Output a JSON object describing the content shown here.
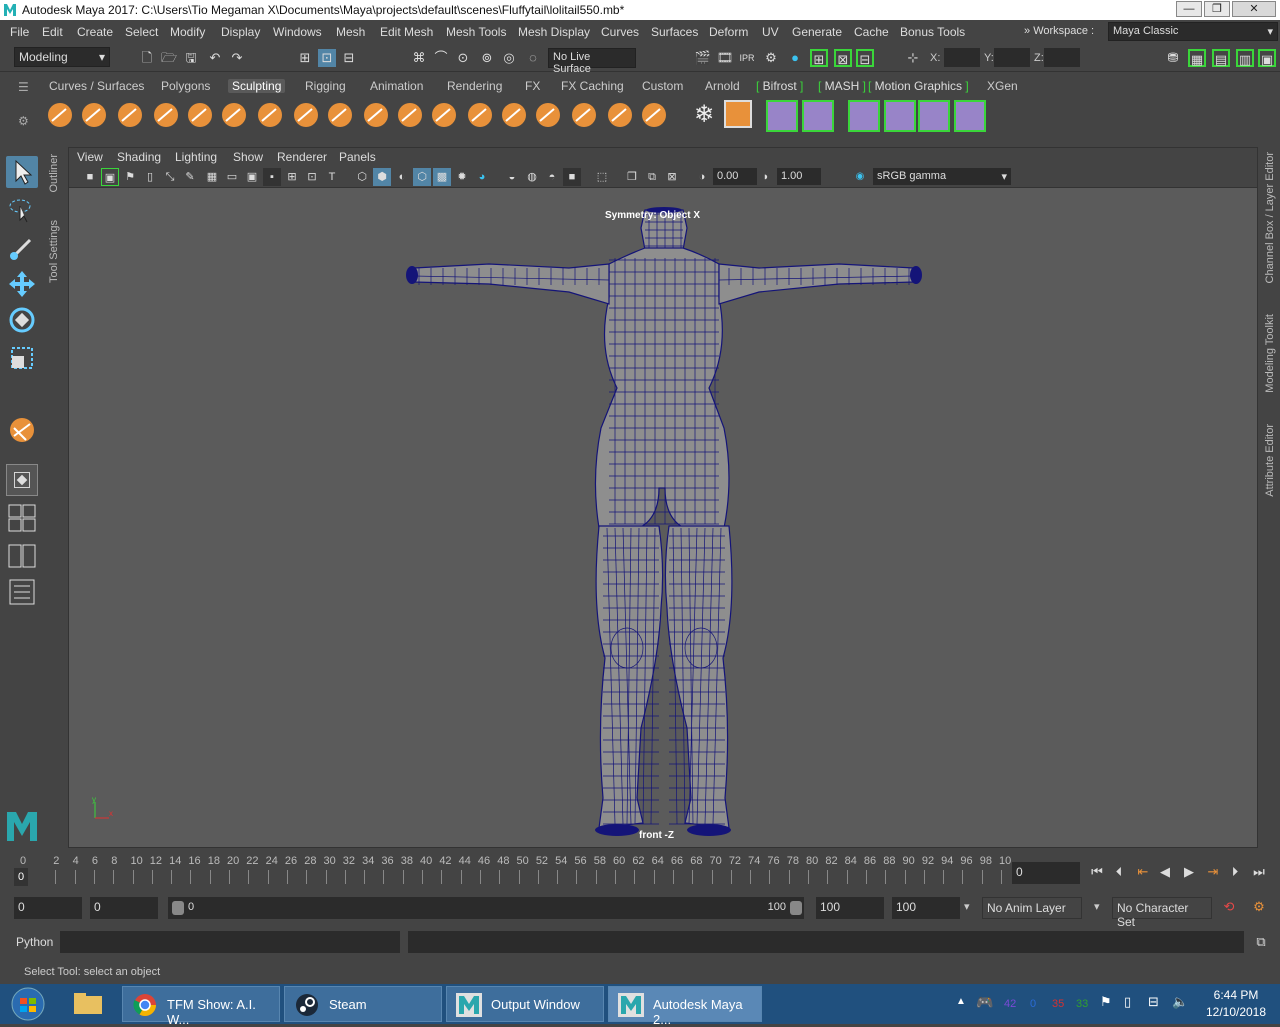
{
  "window": {
    "title": "Autodesk Maya 2017: C:\\Users\\Tio Megaman X\\Documents\\Maya\\projects\\default\\scenes\\Fluffytail\\lolitail550.mb*",
    "app_icon": "maya-m-icon"
  },
  "menubar": {
    "items": [
      "File",
      "Edit",
      "Create",
      "Select",
      "Modify",
      "Display",
      "Windows",
      "Mesh",
      "Edit Mesh",
      "Mesh Tools",
      "Mesh Display",
      "Curves",
      "Surfaces",
      "Deform",
      "UV",
      "Generate",
      "Cache",
      "Bonus Tools"
    ],
    "workspace_label": "Workspace :",
    "workspace_value": "Maya Classic"
  },
  "statusline": {
    "mode": "Modeling",
    "live_surface": "No Live Surface",
    "x_label": "X:",
    "y_label": "Y:",
    "z_label": "Z:"
  },
  "shelf": {
    "tabs": [
      "Curves / Surfaces",
      "Polygons",
      "Sculpting",
      "Rigging",
      "Animation",
      "Rendering",
      "FX",
      "FX Caching",
      "Custom",
      "Arnold",
      "Bifrost",
      "MASH",
      "Motion Graphics",
      "XGen"
    ],
    "active_tab": "Sculpting",
    "colors": {
      "sculpt_orange": "#e8913a",
      "accent_green": "#3ad63a",
      "mash_purple": "#9884c8"
    }
  },
  "sidetabs": {
    "outliner": "Outliner",
    "tool_settings": "Tool Settings"
  },
  "rightbar": {
    "channel_box": "Channel Box / Layer Editor",
    "modeling_toolkit": "Modeling Toolkit",
    "attribute_editor": "Attribute Editor"
  },
  "viewport": {
    "menu": [
      "View",
      "Shading",
      "Lighting",
      "Show",
      "Renderer",
      "Panels"
    ],
    "exposure": "0.00",
    "gamma": "1.00",
    "color_space": "sRGB gamma",
    "symmetry_label": "Symmetry: Object X",
    "camera_label": "front -Z",
    "axis_y": "y",
    "axis_x": "x",
    "colors": {
      "background": "#5b5b5b",
      "mesh_fill": "#8e8e8e",
      "wire": "#141478"
    }
  },
  "timeslider": {
    "ticks": [
      "2",
      "4",
      "6",
      "8",
      "10",
      "12",
      "14",
      "16",
      "18",
      "20",
      "22",
      "24",
      "26",
      "28",
      "30",
      "32",
      "34",
      "36",
      "38",
      "40",
      "42",
      "44",
      "46",
      "48",
      "50",
      "52",
      "54",
      "56",
      "58",
      "60",
      "62",
      "64",
      "66",
      "68",
      "70",
      "72",
      "74",
      "76",
      "78",
      "80",
      "82",
      "84",
      "86",
      "88",
      "90",
      "92",
      "94",
      "96",
      "98",
      "10"
    ],
    "start_tick": "0",
    "current_frame_marker": "0",
    "current_frame": "0"
  },
  "rangeslider": {
    "start": "0",
    "playback_start": "0",
    "slider_start": "0",
    "slider_end": "100",
    "playback_end": "100",
    "end": "100",
    "anim_layer": "No Anim Layer",
    "character_set": "No Character Set"
  },
  "cmdline": {
    "language": "Python"
  },
  "helpline": {
    "text": "Select Tool: select an object"
  },
  "taskbar": {
    "tasks": [
      "TFM Show: A.I. W...",
      "Steam",
      "Output Window",
      "Autodesk Maya 2..."
    ],
    "time": "6:44 PM",
    "date": "12/10/2018",
    "tray_numbers": [
      "42",
      "0",
      "35",
      "33"
    ]
  }
}
